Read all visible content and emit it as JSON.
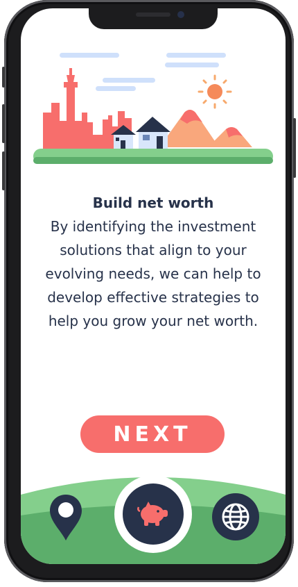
{
  "onboarding": {
    "title": "Build net worth",
    "description": "By identifying the investment solutions that align to your evolving needs, we can help to develop effective strategies to help you grow your net worth."
  },
  "actions": {
    "next_label": "NEXT"
  },
  "bottom_nav": {
    "items": [
      {
        "icon": "location-pin-icon"
      },
      {
        "icon": "piggy-bank-icon",
        "active": true
      },
      {
        "icon": "globe-icon"
      }
    ]
  },
  "colors": {
    "primary_text": "#27324a",
    "accent_coral": "#f76e6c",
    "ground_green": "#84cf8c",
    "sky_blue": "#cfe0fb",
    "sun_orange": "#f58a5a"
  }
}
